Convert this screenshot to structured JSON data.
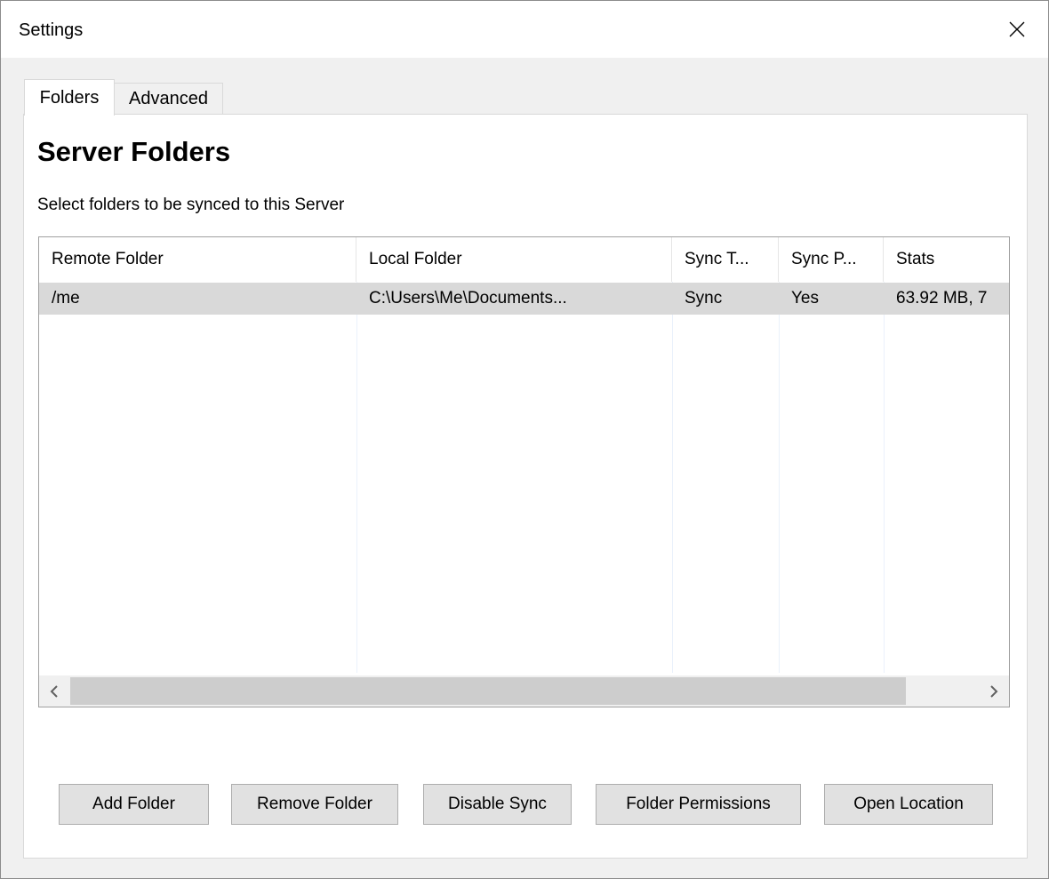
{
  "window": {
    "title": "Settings"
  },
  "tabs": [
    {
      "label": "Folders",
      "active": true
    },
    {
      "label": "Advanced",
      "active": false
    }
  ],
  "main": {
    "heading": "Server Folders",
    "subtitle": "Select folders to be synced to this Server"
  },
  "table": {
    "columns": [
      "Remote Folder",
      "Local Folder",
      "Sync T...",
      "Sync P...",
      "Stats"
    ],
    "rows": [
      [
        "/me",
        "C:\\Users\\Me\\Documents...",
        "Sync",
        "Yes",
        "63.92 MB, 7"
      ]
    ]
  },
  "buttons": {
    "add_folder": "Add Folder",
    "remove_folder": "Remove Folder",
    "disable_sync": "Disable Sync",
    "folder_permissions": "Folder Permissions",
    "open_location": "Open Location"
  },
  "icons": {
    "close": "close-icon",
    "scroll_left": "chevron-left-icon",
    "scroll_right": "chevron-right-icon"
  },
  "colors": {
    "selected_row": "#d9d9d9",
    "button_bg": "#e1e1e1"
  }
}
